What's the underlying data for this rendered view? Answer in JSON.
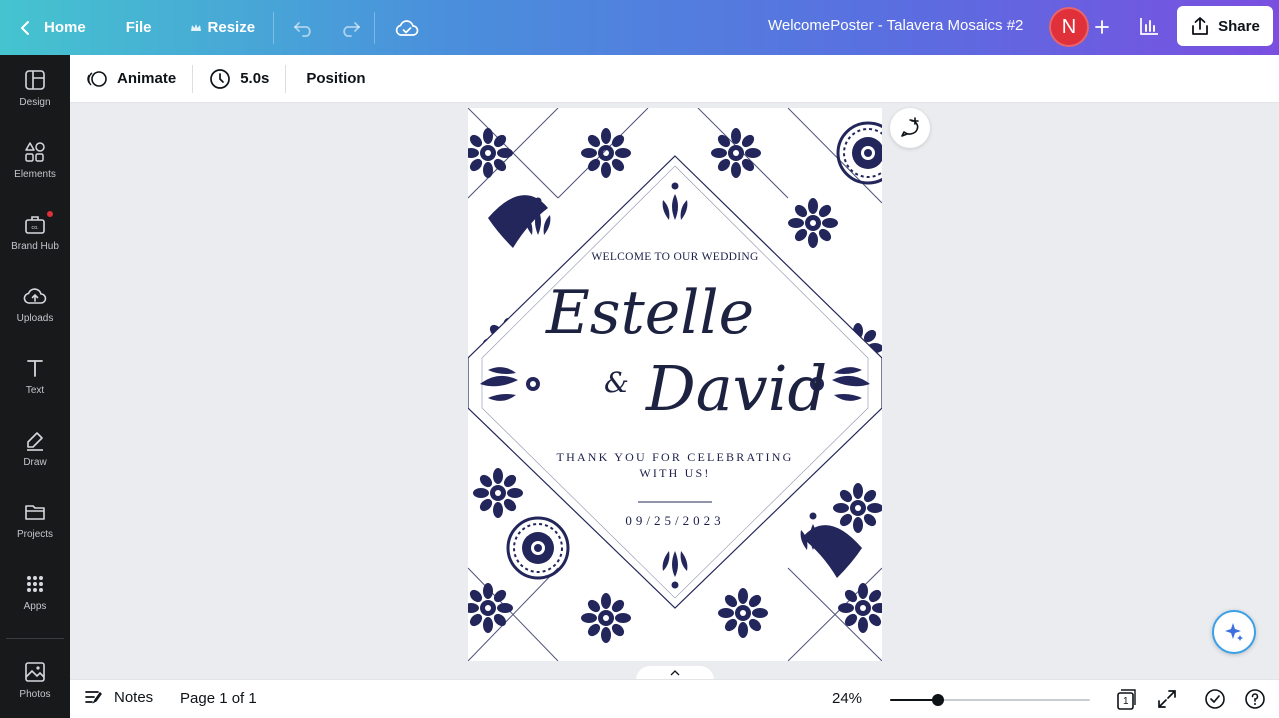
{
  "topbar": {
    "home_label": "Home",
    "file_label": "File",
    "resize_label": "Resize",
    "doc_title": "WelcomePoster - Talavera Mosaics #2",
    "avatar_letter": "N",
    "share_label": "Share"
  },
  "sidebar": {
    "items": [
      {
        "label": "Design",
        "icon": "layout-icon"
      },
      {
        "label": "Elements",
        "icon": "shapes-icon"
      },
      {
        "label": "Brand Hub",
        "icon": "briefcase-icon"
      },
      {
        "label": "Uploads",
        "icon": "cloud-upload-icon"
      },
      {
        "label": "Text",
        "icon": "text-icon"
      },
      {
        "label": "Draw",
        "icon": "pen-icon"
      },
      {
        "label": "Projects",
        "icon": "folder-icon"
      },
      {
        "label": "Apps",
        "icon": "grid-icon"
      },
      {
        "label": "Photos",
        "icon": "image-icon"
      }
    ]
  },
  "context": {
    "animate_label": "Animate",
    "duration_label": "5.0s",
    "position_label": "Position"
  },
  "poster": {
    "welcome": "WELCOME TO OUR WEDDING",
    "name1": "Estelle",
    "amp": "&",
    "name2": "David",
    "thanks_line1": "THANK YOU FOR CELEBRATING",
    "thanks_line2": "WITH US!",
    "date": "09/25/2023",
    "ink_color": "#1c1f4a"
  },
  "bottom": {
    "notes_label": "Notes",
    "page_label": "Page 1 of 1",
    "zoom_label": "24%",
    "zoom_level": 0.24,
    "page_count": "1"
  },
  "colors": {
    "accent_red": "#e0303a",
    "sidebar_bg": "#18191b"
  }
}
